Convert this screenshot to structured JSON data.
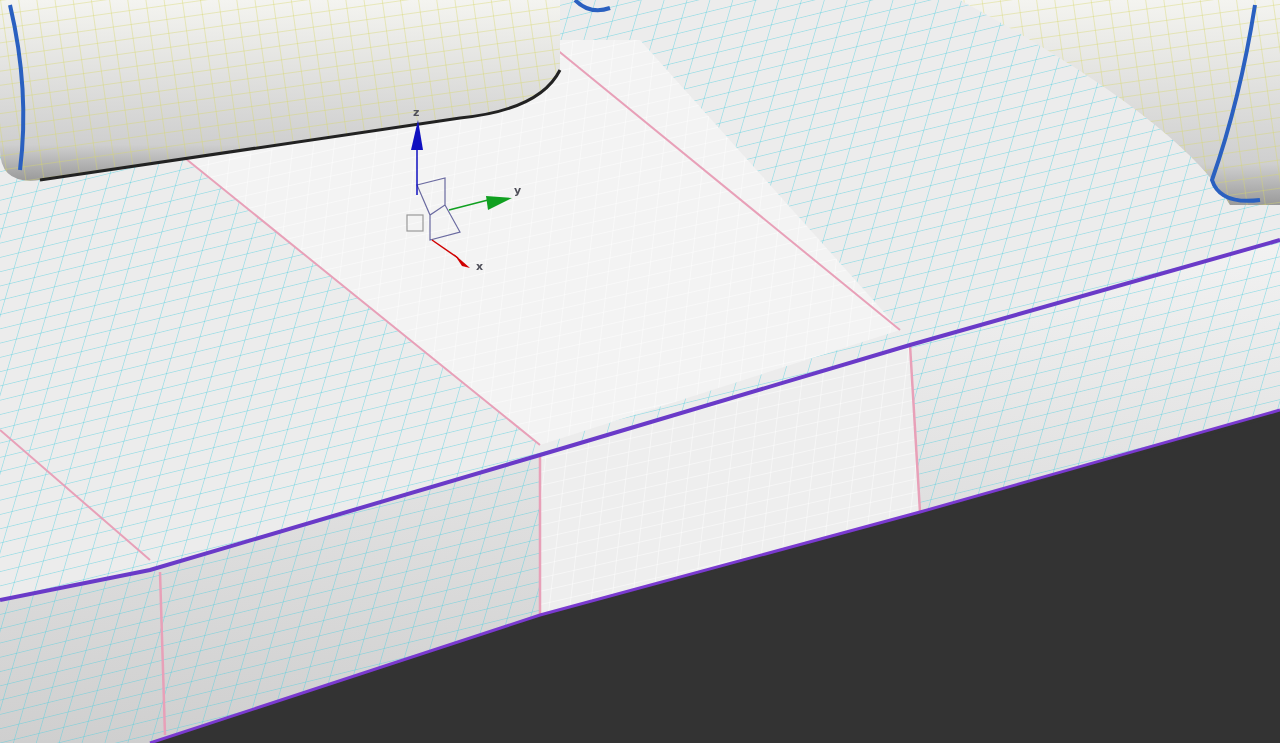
{
  "viewport": {
    "gizmo": {
      "axes": [
        {
          "kind": "z",
          "label": "z",
          "color": "#1010c0"
        },
        {
          "kind": "y",
          "label": "y",
          "color": "#10a020"
        },
        {
          "kind": "x",
          "label": "x",
          "color": "#d00000"
        }
      ]
    }
  }
}
